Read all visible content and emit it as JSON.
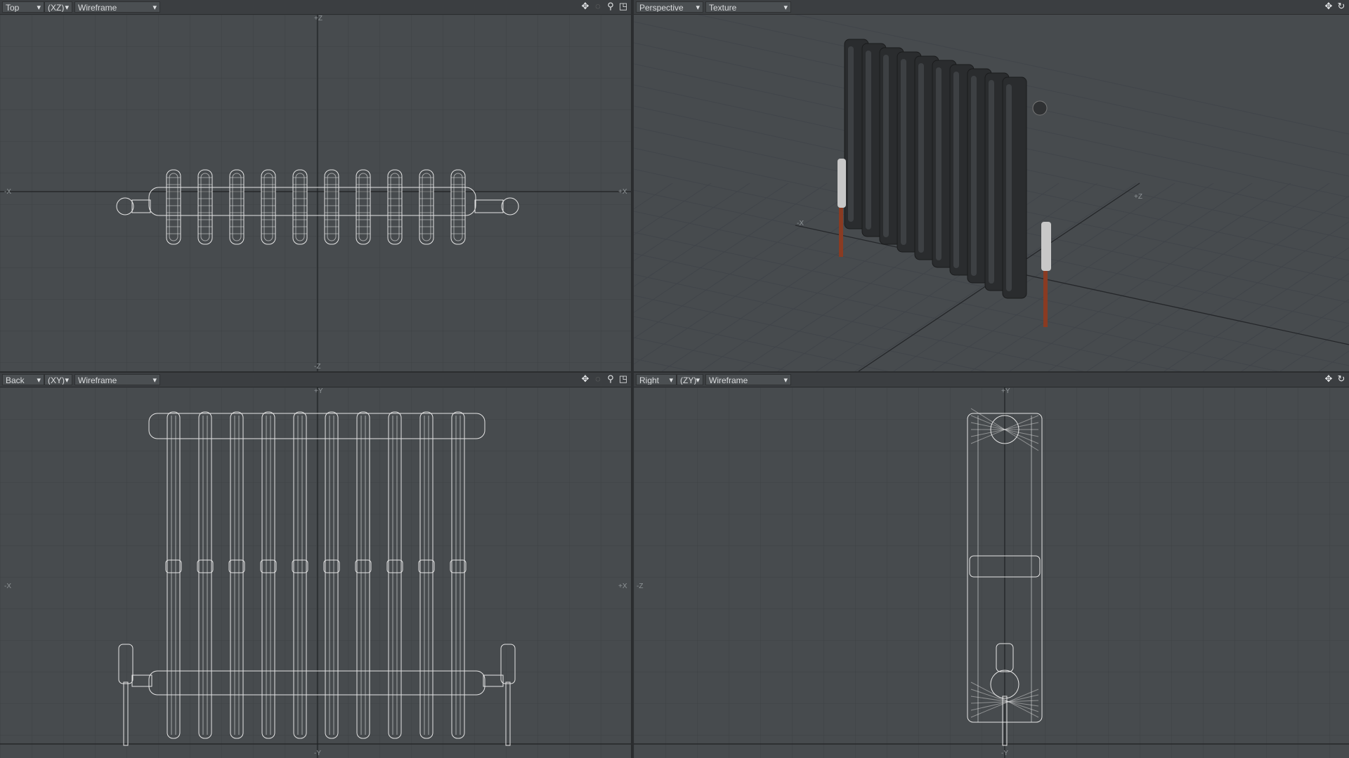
{
  "viewports": {
    "top_left": {
      "view": "Top",
      "plane": "(XZ)",
      "mode": "Wireframe",
      "axis_labels": {
        "left": "-X",
        "right": "+X",
        "top": "+Z",
        "bottom": "-Z"
      }
    },
    "top_right": {
      "view": "Perspective",
      "mode": "Texture",
      "axis_labels": {
        "x": "-X",
        "z": "+Z"
      }
    },
    "bottom_left": {
      "view": "Back",
      "plane": "(XY)",
      "mode": "Wireframe",
      "axis_labels": {
        "left": "-X",
        "right": "+X",
        "top": "+Y",
        "bottom": "-Y"
      }
    },
    "bottom_right": {
      "view": "Right",
      "plane": "(ZY)",
      "mode": "Wireframe",
      "axis_labels": {
        "left": "-Z",
        "top": "+Y",
        "bottom": "-Y"
      }
    }
  },
  "toolbar_icons": [
    "move-view-icon",
    "rotate-view-icon",
    "zoom-view-icon",
    "maximize-view-icon"
  ],
  "colors": {
    "viewport_bg": "#474b4e",
    "grid_minor": "#3f4346",
    "grid_major": "#3a3d40",
    "wireframe": "#e6e6e6",
    "radiator_metal": "#2a2c2e",
    "copper_pipe": "#8a3b22"
  }
}
